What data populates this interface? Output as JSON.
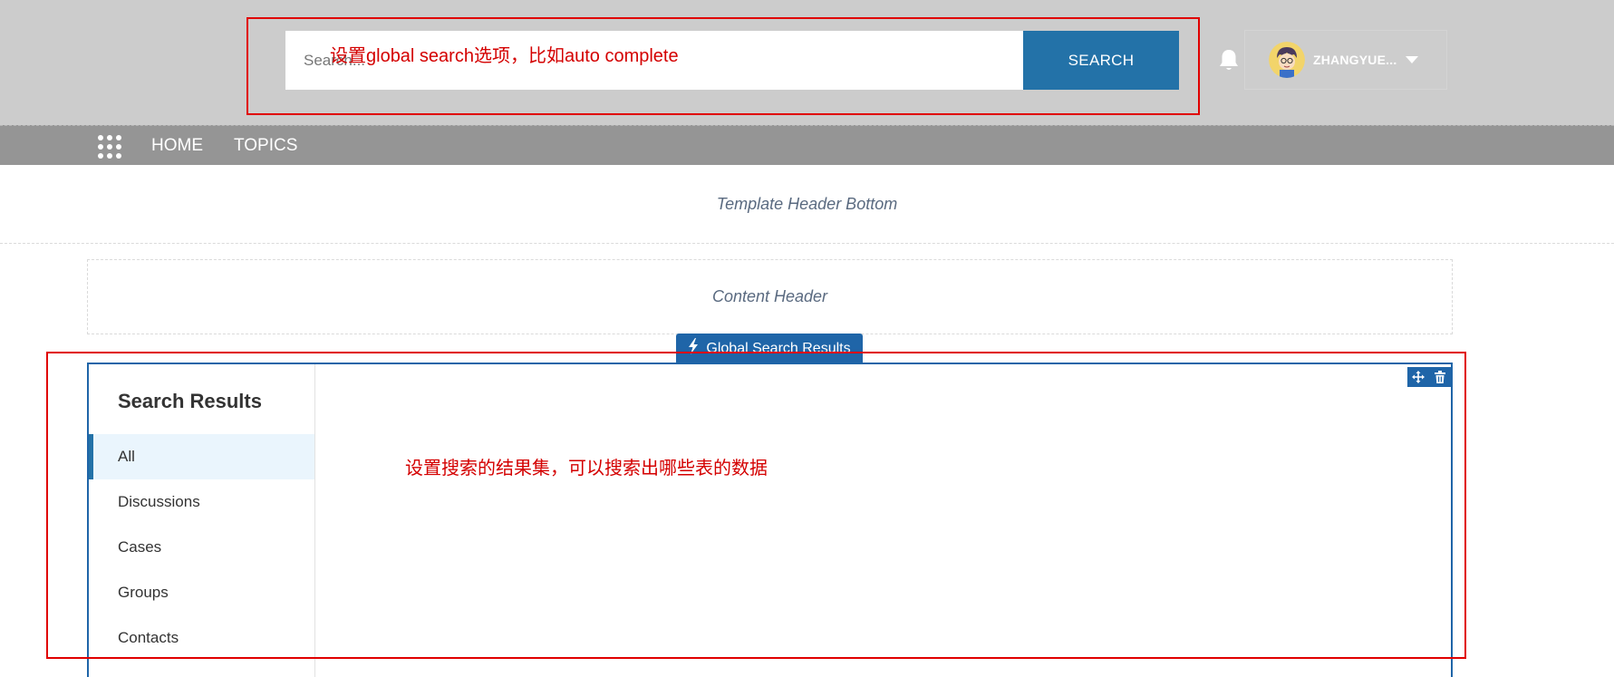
{
  "header": {
    "search": {
      "placeholder": "Search...",
      "button_label": "SEARCH"
    },
    "notifications_icon": "bell-icon",
    "user": {
      "name": "ZHANGYUE...",
      "avatar_icon": "avatar-cartoon",
      "menu_icon": "caret-down-icon"
    }
  },
  "nav": {
    "launcher_icon": "app-launcher-grid-icon",
    "items": [
      {
        "label": "HOME"
      },
      {
        "label": "TOPICS"
      }
    ]
  },
  "regions": {
    "template_header_bottom": "Template Header Bottom",
    "content_header": "Content Header"
  },
  "component": {
    "tab_label": "Global Search Results",
    "tab_icon": "lightning-icon",
    "action_icons": [
      "move-icon",
      "trash-icon"
    ],
    "title": "Search Results",
    "scopes": [
      {
        "label": "All",
        "active": true
      },
      {
        "label": "Discussions",
        "active": false
      },
      {
        "label": "Cases",
        "active": false
      },
      {
        "label": "Groups",
        "active": false
      },
      {
        "label": "Contacts",
        "active": false
      }
    ]
  },
  "annotations": {
    "search_note": "设置global search选项，比如auto complete",
    "results_note": "设置搜索的结果集，可以搜索出哪些表的数据",
    "color": "#e00000"
  },
  "colors": {
    "header_bg": "#cccccc",
    "nav_bg": "#959595",
    "accent": "#2372a8",
    "builder_blue": "#1f65a8",
    "active_scope_bg": "#eaf5fd"
  }
}
